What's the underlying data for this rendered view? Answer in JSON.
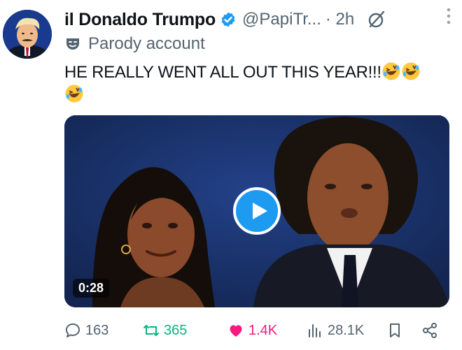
{
  "colors": {
    "accent": "#1d9bf0",
    "text_primary": "#0f1419",
    "text_secondary": "#536471",
    "retweet": "#00ba7c",
    "like": "#f91880"
  },
  "tweet": {
    "author_name": "il Donaldo Trumpo",
    "handle": "@PapiTr...",
    "time": "· 2h",
    "parody_label": "Parody account",
    "text_line": "HE REALLY WENT ALL OUT THIS YEAR!!!",
    "emoji_name": "rolling-on-floor-laughing-emoji",
    "video": {
      "duration": "0:28"
    },
    "stats": {
      "replies": "163",
      "retweets": "365",
      "likes": "1.4K",
      "views": "28.1K"
    }
  },
  "icons": {
    "verified": "verified-badge-icon",
    "grok": "grok-icon",
    "more": "more-icon",
    "parody": "parody-mask-icon",
    "play": "play-icon",
    "reply": "reply-icon",
    "retweet": "retweet-icon",
    "like": "heart-icon",
    "views": "views-icon",
    "bookmark": "bookmark-icon",
    "share": "share-icon"
  }
}
